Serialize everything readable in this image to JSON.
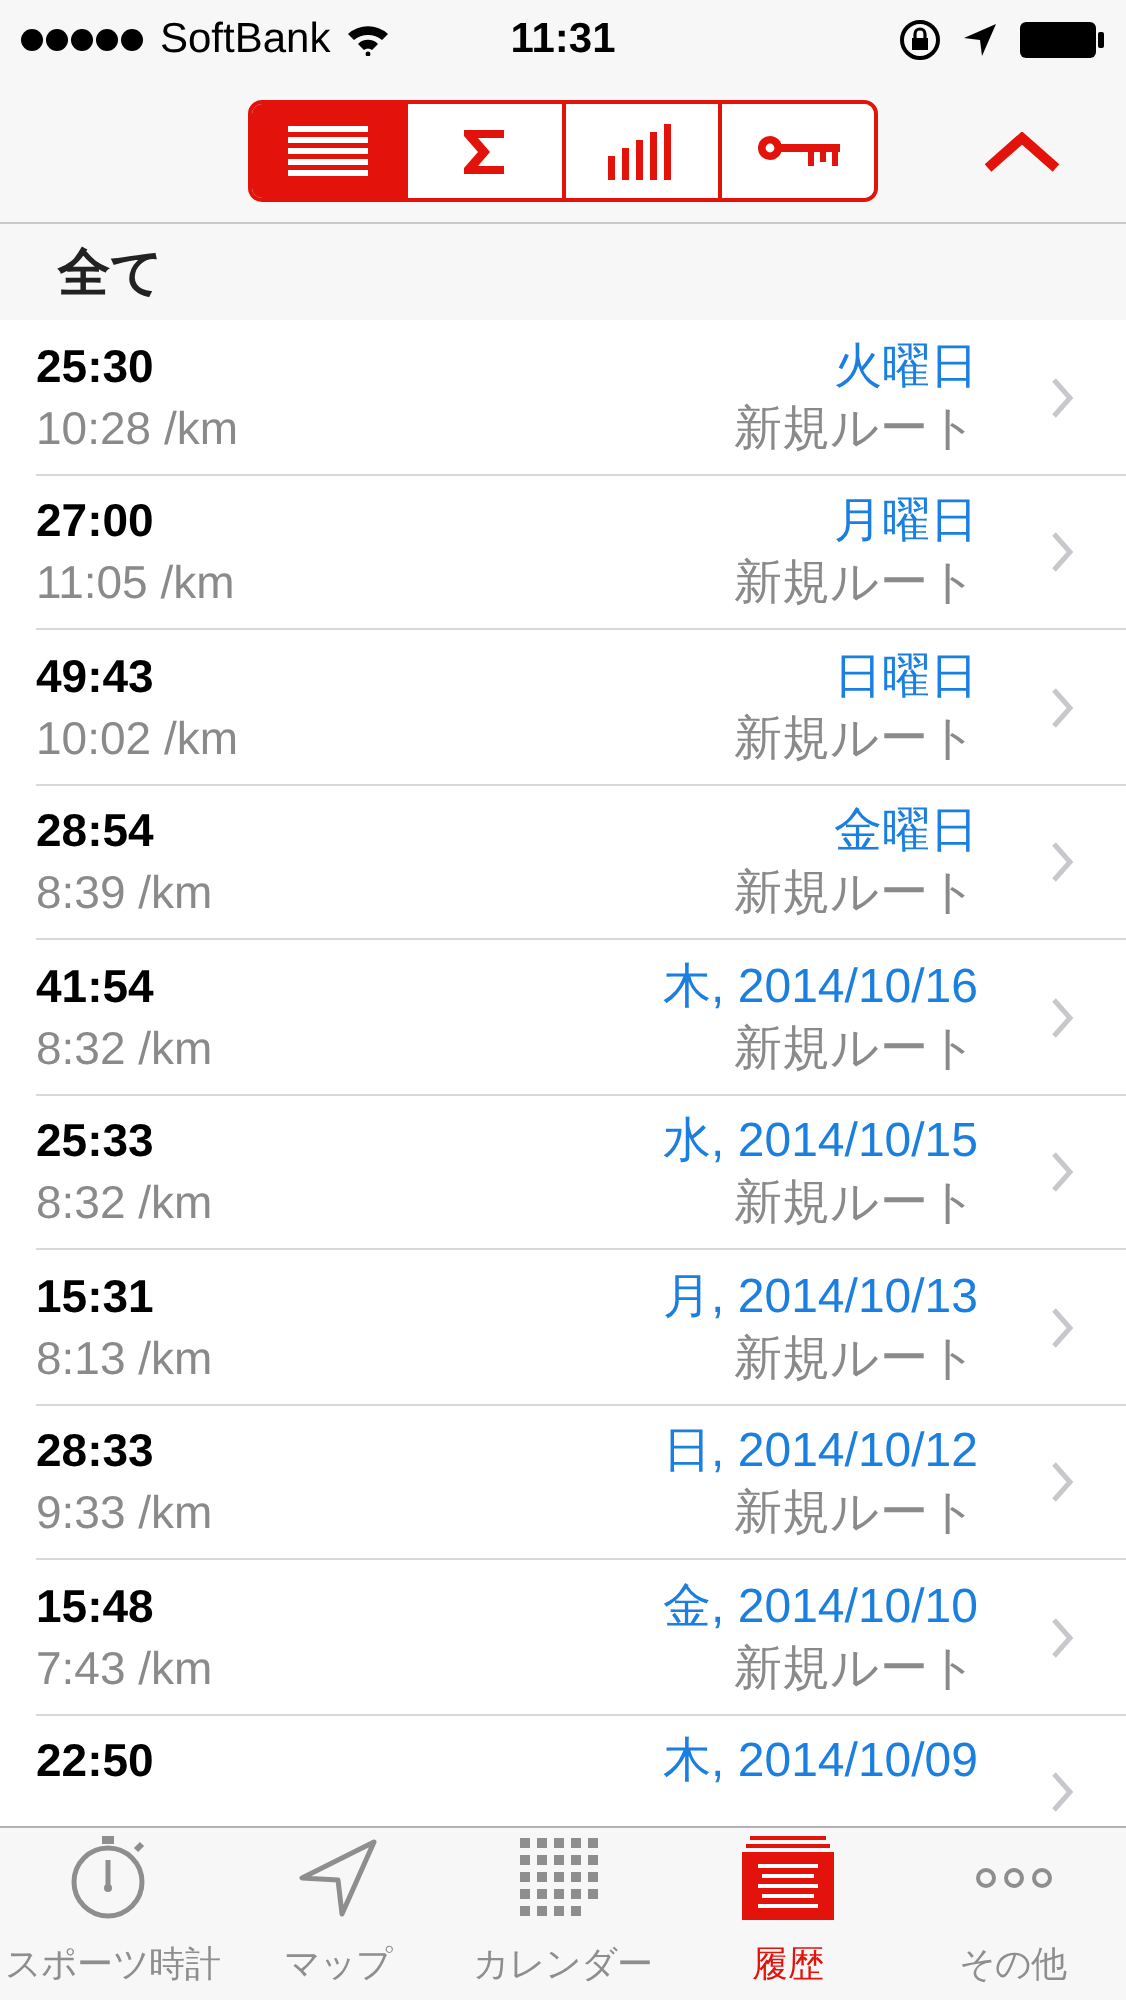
{
  "status_bar": {
    "carrier": "SoftBank",
    "time": "11:31"
  },
  "segments": [
    {
      "kind": "list",
      "selected": true
    },
    {
      "kind": "sum",
      "selected": false
    },
    {
      "kind": "bars",
      "selected": false
    },
    {
      "kind": "key",
      "selected": false
    }
  ],
  "section": {
    "title": "全て"
  },
  "rows": [
    {
      "duration": "25:30",
      "pace": "10:28 /km",
      "date": "火曜日",
      "route": "新規ルート"
    },
    {
      "duration": "27:00",
      "pace": "11:05 /km",
      "date": "月曜日",
      "route": "新規ルート"
    },
    {
      "duration": "49:43",
      "pace": "10:02 /km",
      "date": "日曜日",
      "route": "新規ルート"
    },
    {
      "duration": "28:54",
      "pace": "8:39 /km",
      "date": "金曜日",
      "route": "新規ルート"
    },
    {
      "duration": "41:54",
      "pace": "8:32 /km",
      "date": "木, 2014/10/16",
      "route": "新規ルート"
    },
    {
      "duration": "25:33",
      "pace": "8:32 /km",
      "date": "水, 2014/10/15",
      "route": "新規ルート"
    },
    {
      "duration": "15:31",
      "pace": "8:13 /km",
      "date": "月, 2014/10/13",
      "route": "新規ルート"
    },
    {
      "duration": "28:33",
      "pace": "9:33 /km",
      "date": "日, 2014/10/12",
      "route": "新規ルート"
    },
    {
      "duration": "15:48",
      "pace": "7:43 /km",
      "date": "金, 2014/10/10",
      "route": "新規ルート"
    },
    {
      "duration": "22:50",
      "date": "木, 2014/10/09"
    }
  ],
  "tab_bar": [
    {
      "kind": "stopwatch",
      "label": "スポーツ時計",
      "selected": false
    },
    {
      "kind": "map",
      "label": "マップ",
      "selected": false
    },
    {
      "kind": "calendar",
      "label": "カレンダー",
      "selected": false
    },
    {
      "kind": "history",
      "label": "履歴",
      "selected": true
    },
    {
      "kind": "more",
      "label": "その他",
      "selected": false
    }
  ]
}
